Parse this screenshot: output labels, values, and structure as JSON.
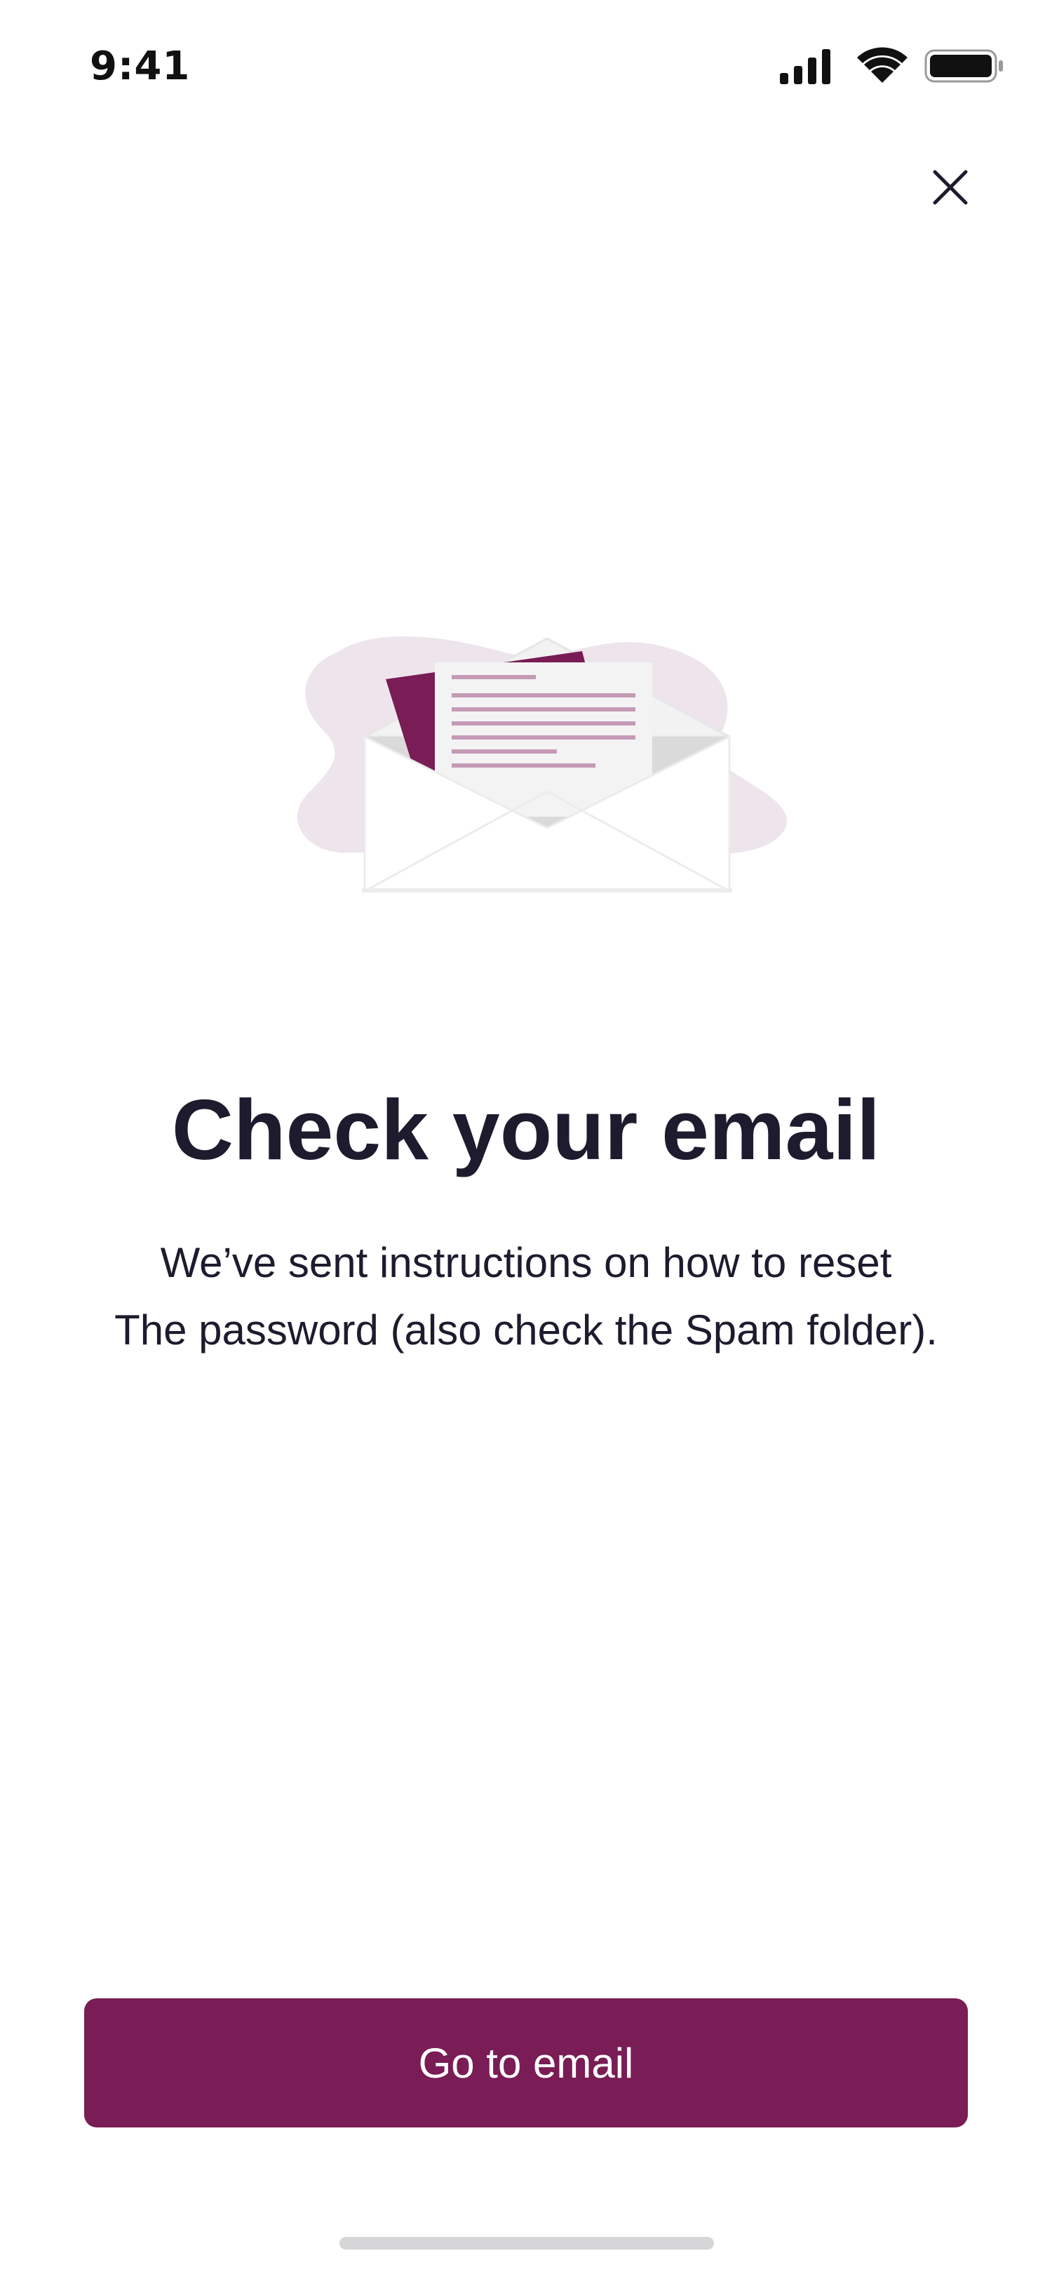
{
  "status_bar": {
    "time": "9:41",
    "icons": [
      "cellular-signal-icon",
      "wifi-icon",
      "battery-icon"
    ]
  },
  "header": {
    "close_icon": "close-icon"
  },
  "illustration": {
    "icon": "open-envelope-illustration",
    "accent_color": "#7a1c55",
    "blob_color": "#eee5ec"
  },
  "content": {
    "title": "Check your email",
    "subtitle_line1": "We’ve sent instructions on how to reset",
    "subtitle_line2": "The password (also check the Spam folder)."
  },
  "actions": {
    "primary_label": "Go to email",
    "primary_color": "#7a1c55"
  }
}
